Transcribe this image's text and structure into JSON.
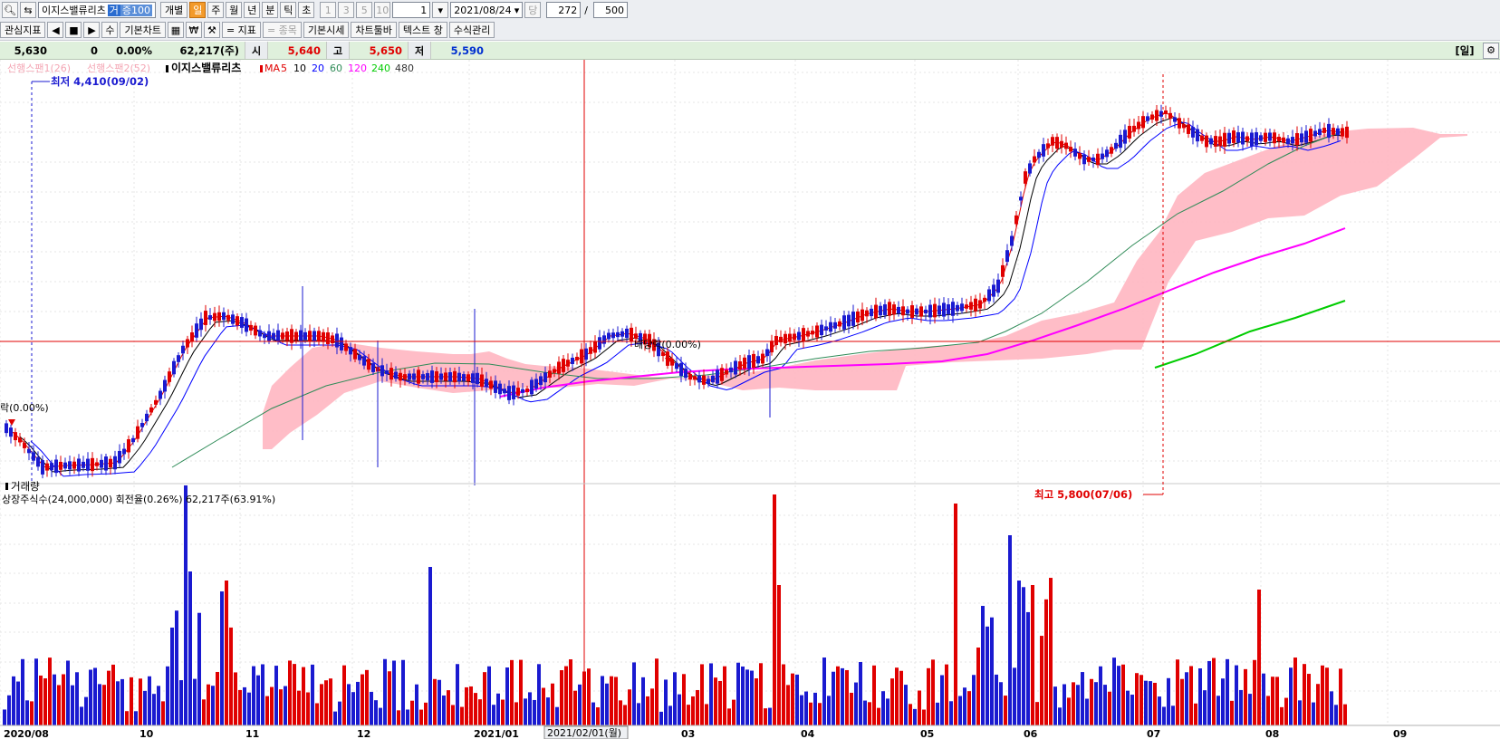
{
  "toolbar": {
    "search_icon": "magnifier-icon",
    "refresh_icon": "refresh-icon",
    "stock_name": "이지스밸류리츠",
    "tag_a": "거",
    "tag_b": "증100",
    "individual": "개별",
    "periods": [
      "일",
      "주",
      "월",
      "년",
      "분",
      "틱",
      "초"
    ],
    "active_period": "일",
    "numbers": [
      "1",
      "3",
      "5",
      "10"
    ],
    "count_value": "1",
    "date": "2021/08/24",
    "label_dang": "당",
    "shown": "272",
    "slash": "/",
    "total": "500"
  },
  "toolbar2": {
    "interest": "관심지표",
    "su": "수",
    "basic_chart": "기본차트",
    "add_indicator": "= 지표",
    "add_stock": "= 종목",
    "basic_quote": "기본시세",
    "chart_toolbar": "차트툴바",
    "text_window": "텍스트 창",
    "formula": "수식관리"
  },
  "pricebar": {
    "price": "5,630",
    "change": "0",
    "rate": "0.00%",
    "volume": "62,217(주)",
    "open_label": "시",
    "open": "5,640",
    "high_label": "고",
    "high": "5,650",
    "low_label": "저",
    "low": "5,590",
    "period_tag": "[일]",
    "settings_icon": "gear-icon"
  },
  "chart": {
    "legend_span1": "선행스팬1(26)",
    "legend_span2": "선행스팬2(52)",
    "stock": "이지스밸류리츠",
    "ma_label": "MA",
    "ma_periods": [
      "5",
      "10",
      "20",
      "60",
      "120",
      "240",
      "480"
    ],
    "ma_colors": [
      "#e00000",
      "#000000",
      "#0000ff",
      "#2e8b57",
      "#ff00ff",
      "#00cc00",
      "#333333"
    ],
    "low_annotation": "최저 4,410(09/02)",
    "high_annotation": "최고 5,800(07/06)",
    "left_marker": "락(0.00%)",
    "mid_marker": "배당락(0.00%)",
    "volume_title": "거래량",
    "volume_info": "상장주식수(24,000,000) 회전율(0.26%) 62,217주(63.91%)",
    "x_ticks": [
      "2020/08",
      "10",
      "11",
      "12",
      "2021/01",
      "03",
      "04",
      "05",
      "06",
      "07",
      "08",
      "09"
    ],
    "cursor_date": "2021/02/01(월)",
    "colors": {
      "up": "#e00000",
      "down": "#1a1ad0",
      "cloud": "#ffb6c1"
    }
  }
}
